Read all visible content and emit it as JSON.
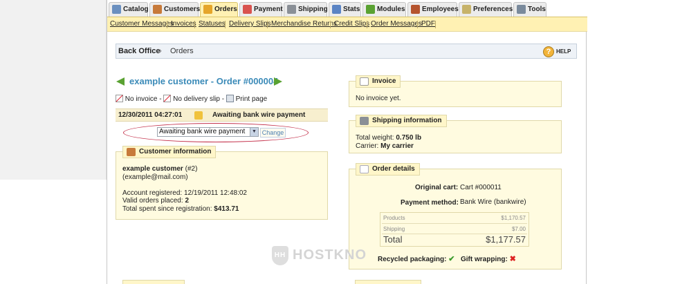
{
  "tabs": [
    {
      "label": "Catalog",
      "icon": "catalog-icon",
      "color": "#6a8fbf"
    },
    {
      "label": "Customers",
      "icon": "customers-icon",
      "color": "#c77a3a"
    },
    {
      "label": "Orders",
      "icon": "orders-icon",
      "color": "#e5a52a",
      "active": true
    },
    {
      "label": "Payment",
      "icon": "payment-icon",
      "color": "#d9534f"
    },
    {
      "label": "Shipping",
      "icon": "shipping-icon",
      "color": "#8a8f96"
    },
    {
      "label": "Stats",
      "icon": "stats-icon",
      "color": "#5b84c4"
    },
    {
      "label": "Modules",
      "icon": "modules-icon",
      "color": "#5aa232"
    },
    {
      "label": "Employees",
      "icon": "employees-icon",
      "color": "#b5542e"
    },
    {
      "label": "Preferences",
      "icon": "preferences-icon",
      "color": "#c7b36a"
    },
    {
      "label": "Tools",
      "icon": "tools-icon",
      "color": "#7a8a9c"
    }
  ],
  "subtabs": [
    "Customer Messages",
    "Invoices",
    "Statuses",
    "Delivery Slips",
    "Merchandise Returns",
    "Credit Slips",
    "Order Messages",
    "PDF"
  ],
  "breadcrumb": {
    "home": "Back Office",
    "current": "Orders",
    "help": "HELP"
  },
  "order": {
    "title": "example customer - Order #000004",
    "no_invoice": "No invoice -",
    "no_delivery": "No delivery slip -",
    "print": "Print page",
    "status_date": "12/30/2011 04:27:01",
    "status_text": "Awaiting bank wire payment",
    "select_value": "Awaiting bank wire payment",
    "change_label": "Change"
  },
  "customer": {
    "legend": "Customer information",
    "name": "example customer",
    "id": "(#2)",
    "email": "(example@mail.com)",
    "registered_label": "Account registered:",
    "registered_value": "12/19/2011 12:48:02",
    "valid_label": "Valid orders placed:",
    "valid_value": "2",
    "spent_label": "Total spent since registration:",
    "spent_value": "$413.71"
  },
  "invoice": {
    "legend": "Invoice",
    "text": "No invoice yet."
  },
  "shipping": {
    "legend": "Shipping information",
    "weight_label": "Total weight:",
    "weight_value": "0.750 lb",
    "carrier_label": "Carrier:",
    "carrier_value": "My carrier"
  },
  "details": {
    "legend": "Order details",
    "cart_label": "Original cart:",
    "cart_value": "Cart #000011",
    "payment_label": "Payment method:",
    "payment_value": "Bank Wire (bankwire)",
    "products_label": "Products",
    "products_value": "$1,170.57",
    "shipping_label": "Shipping",
    "shipping_value": "$7.00",
    "total_label": "Total",
    "total_value": "$1,177.57",
    "recycled_label": "Recycled packaging:",
    "gift_label": "Gift wrapping:"
  },
  "watermark": "HOSTKNO"
}
